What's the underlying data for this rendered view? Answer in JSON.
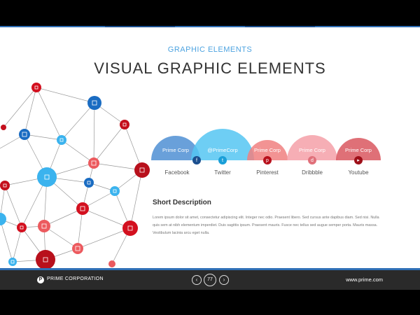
{
  "header": {
    "subtitle": "GRAPHIC ELEMENTS",
    "title": "VISUAL GRAPHIC ELEMENTS"
  },
  "arcs": [
    {
      "label": "Prime Corp",
      "social": "Facebook",
      "color": "#4f8fd4",
      "icon": "facebook-icon"
    },
    {
      "label": "@PrimeCorp",
      "social": "Twitter",
      "color": "#55c6f2",
      "icon": "twitter-icon"
    },
    {
      "label": "Prime Corp",
      "social": "Pinterest",
      "color": "#f08080",
      "icon": "pinterest-icon"
    },
    {
      "label": "Prime Corp",
      "social": "Dribbble",
      "color": "#f5a0a8",
      "icon": "dribbble-icon"
    },
    {
      "label": "Prime Corp",
      "social": "Youtube",
      "color": "#d9575f",
      "icon": "youtube-icon"
    }
  ],
  "description": {
    "heading": "Short Description",
    "body": "Lorem ipsum dolor sit amet, consectetur adipiscing elit. Integer nec odio. Praesent libero. Sed cursus ante dapibus diam. Sed nisi. Nulla quis sem at nibh elementum imperdiet. Duis sagittis ipsum. Praesent mauris. Fusce nec tellus sed augue semper porta. Mauris massa. Vestibulum lacinia arcu eget nulla."
  },
  "footer": {
    "logo_letter": "P",
    "company": "PRIME CORPORATION",
    "page": "77",
    "prev": "‹",
    "next": "›",
    "url": "www.prime.com"
  },
  "colors": {
    "accent_blue": "#2f6fb6",
    "node_blue_dark": "#1b6fc4",
    "node_blue_light": "#3bb3ee",
    "node_red_dark": "#c8101e",
    "node_red_light": "#ec5a5e"
  }
}
